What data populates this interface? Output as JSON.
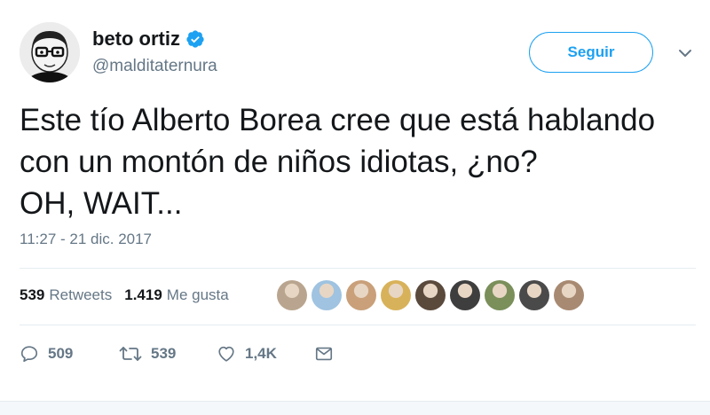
{
  "user": {
    "display_name": "beto ortiz",
    "handle": "@malditaternura",
    "verified": true,
    "avatar_icon": "caricature-avatar"
  },
  "follow_label": "Seguir",
  "tweet": {
    "lines": [
      "Este tío Alberto Borea cree que está hablando",
      "con un montón de niños idiotas, ¿no?",
      "OH, WAIT..."
    ],
    "timestamp": "11:27 - 21 dic. 2017"
  },
  "stats": {
    "retweets_count": "539",
    "retweets_label": "Retweets",
    "likes_count": "1.419",
    "likes_label": "Me gusta"
  },
  "likers": [
    {
      "color": "#b9a58f"
    },
    {
      "color": "#9fc3e0"
    },
    {
      "color": "#c9a07a"
    },
    {
      "color": "#d8b25a"
    },
    {
      "color": "#5a4a3c"
    },
    {
      "color": "#3e3e3e"
    },
    {
      "color": "#7a8f5a"
    },
    {
      "color": "#4a4a4a"
    },
    {
      "color": "#a88a72"
    }
  ],
  "actions": {
    "reply_count": "509",
    "retweet_count": "539",
    "like_count": "1,4K"
  },
  "colors": {
    "accent": "#1da1f2",
    "secondary_text": "#657786",
    "primary_text": "#14171a"
  }
}
